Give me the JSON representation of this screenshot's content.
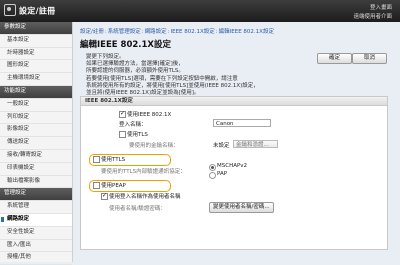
{
  "header": {
    "title": "設定/註冊",
    "link_top": "登入畫面",
    "link_bottom": "遠端使用者介面"
  },
  "sidebar": {
    "items": [
      {
        "label": "參數設定",
        "type": "head"
      },
      {
        "label": "基本設定"
      },
      {
        "label": "計時器設定"
      },
      {
        "label": "圖形設定"
      },
      {
        "label": "主機環境設定"
      },
      {
        "label": "功能設定",
        "type": "head"
      },
      {
        "label": "一般設定"
      },
      {
        "label": "列印設定"
      },
      {
        "label": "影像設定"
      },
      {
        "label": "傳送設定"
      },
      {
        "label": "接收/轉寄設定"
      },
      {
        "label": "印表機設定"
      },
      {
        "label": "輸出檔案影像"
      },
      {
        "label": "管理設定",
        "type": "head"
      },
      {
        "label": "系統管理"
      },
      {
        "label": "網路設定",
        "active": true
      },
      {
        "label": "安全性設定"
      },
      {
        "label": "匯入/匯出"
      },
      {
        "label": "授權/其他"
      }
    ]
  },
  "breadcrumb": [
    "設定/註冊",
    "系統管理設定",
    "網路設定",
    "IEEE 802.1X設定",
    "編輯IEEE 802.1X設定"
  ],
  "page": {
    "title": "編輯IEEE 802.1X設定",
    "ok_label": "確定",
    "cancel_label": "取消",
    "description": "變更下列設定。\n如果已選擇驗證方法，當選擇[確定]後，\n所要認證的伺服器，必須額外使用TLS。\n若要使用[使用TLS]選項，需要在下列設定按鈕中開啟，請注意\n系統將使用所有的設定，將使用[使用TLS]並使用(IEEE 802.1X)設定，\n並且將(使用IEEE 802.1X)設定並設為[使用]。"
  },
  "form": {
    "section_title": "IEEE 802.1X設定",
    "use_ieee_label": "使用IEEE 802.1X",
    "use_ieee_checked": true,
    "login_name_label": "登入名稱：",
    "login_name_value": "Canon",
    "use_tls_label": "使用TLS",
    "use_tls_checked": false,
    "key_cert_label": "要使用的金鑰名稱：",
    "key_status_label": "未設定",
    "key_button_label": "金鑰和憑證...",
    "use_ttls_label": "使用TTLS",
    "use_ttls_checked": false,
    "ttls_inner_label": "要使用的TTLS內部驗證通訊協定：",
    "ttls_opt1": "MSCHAPv2",
    "ttls_opt2": "PAP",
    "use_peap_label": "使用PEAP",
    "use_peap_checked": false,
    "use_login_as_user_label": "使用登入名稱作為使用者名稱",
    "use_login_as_user_checked": true,
    "user_name_pass_label": "使用者名稱/驗證密碼：",
    "change_user_button_label": "變更使用者名稱/密碼..."
  }
}
